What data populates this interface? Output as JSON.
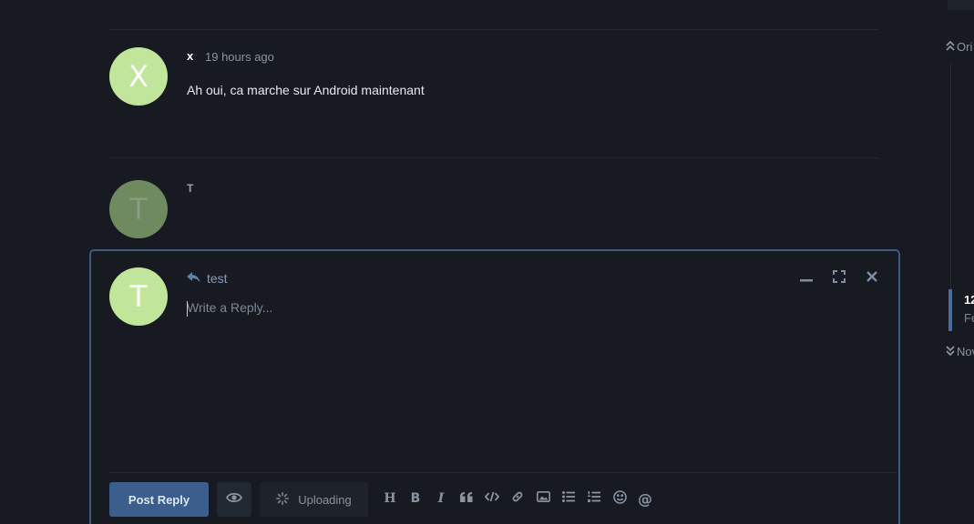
{
  "posts": [
    {
      "avatar_letter": "X",
      "avatar_color": "#c2e59c",
      "username": "x",
      "time": "19 hours ago",
      "body": "Ah oui, ca marche sur Android maintenant"
    },
    {
      "avatar_letter": "T",
      "avatar_color": "#6f8a5f",
      "username": "T"
    }
  ],
  "composer": {
    "avatar_letter": "T",
    "avatar_color": "#c2e59c",
    "reply_to": "test",
    "placeholder": "Write a Reply...",
    "post_button": "Post Reply",
    "uploading_label": "Uploading",
    "border_color": "#3d5a7c",
    "accent": "#3b5e8c",
    "icons": [
      "minimize-icon",
      "fullscreen-icon",
      "close-icon",
      "reply-icon",
      "preview-eye-icon",
      "spinner-icon"
    ],
    "toolbar_icons": [
      "heading-icon",
      "bold-icon",
      "italic-icon",
      "quote-icon",
      "code-icon",
      "link-icon",
      "image-icon",
      "bulleted-list-icon",
      "numbered-list-icon",
      "emoji-icon",
      "mention-icon"
    ]
  },
  "timeline": {
    "original_label": "Ori",
    "count_label": "12",
    "date_label": "Fe",
    "now_label": "Nov"
  }
}
